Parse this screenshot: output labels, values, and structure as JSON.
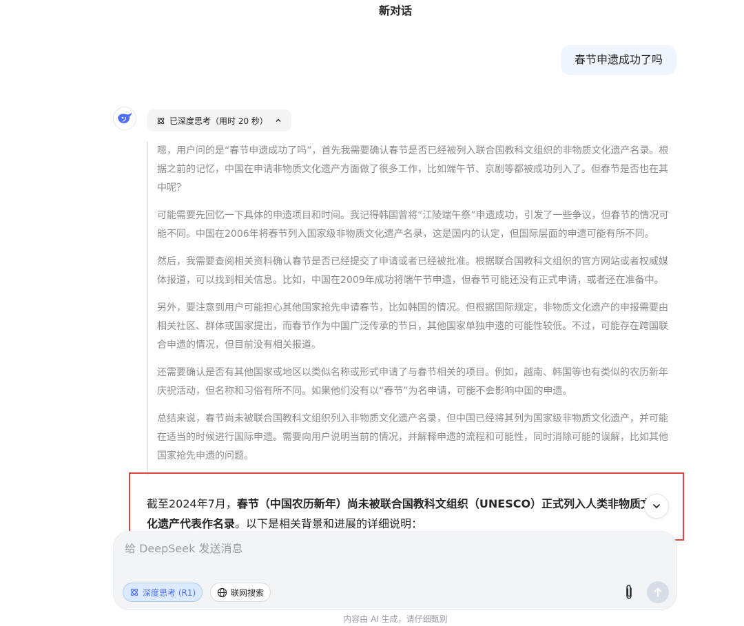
{
  "header": {
    "title": "新对话"
  },
  "conversation": {
    "user_message": "春节申遗成功了吗",
    "thinking": {
      "status_label": "已深度思考（用时 20 秒）",
      "paragraphs": [
        "嗯，用户问的是“春节申遗成功了吗”，首先我需要确认春节是否已经被列入联合国教科文组织的非物质文化遗产名录。根据之前的记忆，中国在申请非物质文化遗产方面做了很多工作，比如端午节、京剧等都被成功列入了。但春节是否也在其中呢？",
        "可能需要先回忆一下具体的申遗项目和时间。我记得韩国曾将“江陵端午祭”申遗成功，引发了一些争议，但春节的情况可能不同。中国在2006年将春节列入国家级非物质文化遗产名录，这是国内的认定，但国际层面的申遗可能有所不同。",
        "然后，我需要查阅相关资料确认春节是否已经提交了申请或者已经被批准。根据联合国教科文组织的官方网站或者权威媒体报道，可以找到相关信息。比如，中国在2009年成功将端午节申遗，但春节可能还没有正式申请，或者还在准备中。",
        "另外，要注意到用户可能担心其他国家抢先申请春节，比如韩国的情况。但根据国际规定，非物质文化遗产的申报需要由相关社区、群体或国家提出，而春节作为中国广泛传承的节日，其他国家单独申遗的可能性较低。不过，可能存在跨国联合申遗的情况，但目前没有相关报道。",
        "还需要确认是否有其他国家或地区以类似名称或形式申请了与春节相关的项目。例如，越南、韩国等也有类似的农历新年庆祝活动，但名称和习俗有所不同。如果他们没有以“春节”为名申请，可能不会影响中国的申遗。",
        "总结来说，春节尚未被联合国教科文组织列入非物质文化遗产名录，但中国已经将其列为国家级非物质文化遗产，并可能在适当的时候进行国际申遗。需要向用户说明当前的情况，并解释申遗的流程和可能性，同时消除可能的误解，比如其他国家抢先申遗的问题。"
      ]
    },
    "answer": {
      "prefix": "截至2024年7月，",
      "bold": "春节（中国农历新年）尚未被联合国教科文组织（UNESCO）正式列入人类非物质文化遗产代表作名录",
      "suffix": "。以下是相关背景和进展的详细说明："
    }
  },
  "composer": {
    "placeholder": "给 DeepSeek 发送消息",
    "deep_think_label": "深度思考 (R1)",
    "web_search_label": "联网搜索"
  },
  "footer": {
    "disclaimer": "内容由 AI 生成，请仔细甄别"
  },
  "colors": {
    "accent": "#4d6bfe",
    "highlight": "#e0453a",
    "user_bubble": "#eff6ff"
  }
}
